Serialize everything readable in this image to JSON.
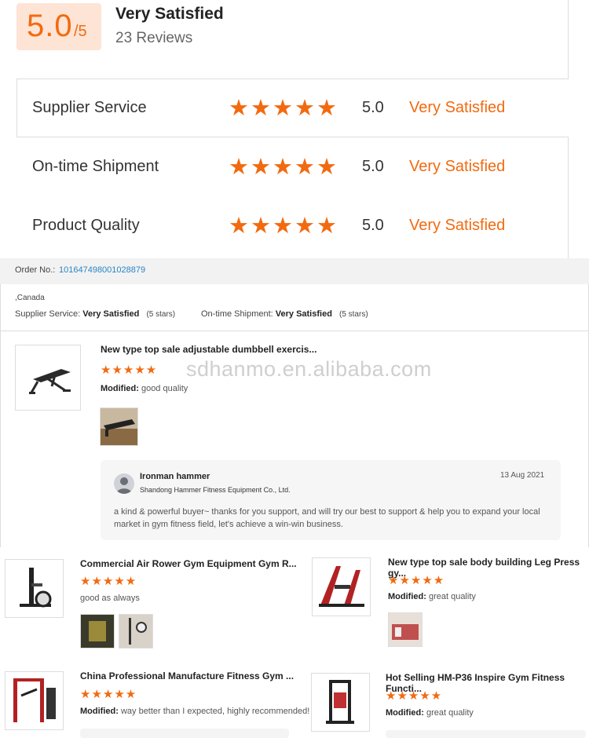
{
  "summary": {
    "score": "5.0",
    "score_max": "/5",
    "title": "Very Satisfied",
    "reviews": "23 Reviews"
  },
  "ratings": [
    {
      "label": "Supplier Service",
      "stars": "★★★★★",
      "value": "5.0",
      "status": "Very Satisfied"
    },
    {
      "label": "On-time Shipment",
      "stars": "★★★★★",
      "value": "5.0",
      "status": "Very Satisfied"
    },
    {
      "label": "Product Quality",
      "stars": "★★★★★",
      "value": "5.0",
      "status": "Very Satisfied"
    }
  ],
  "order": {
    "label": "Order No.:",
    "number": "101647498001028879",
    "location": ",Canada",
    "supplier_service_label": "Supplier Service:",
    "supplier_service_value": "Very Satisfied",
    "supplier_service_stars": "(5 stars)",
    "shipment_label": "On-time Shipment:",
    "shipment_value": "Very Satisfied",
    "shipment_stars": "(5 stars)"
  },
  "main_review": {
    "title": "New type top sale adjustable dumbbell exercis...",
    "stars": "★★★★★",
    "modified_label": "Modified:",
    "text": "good quality",
    "watermark": "sdhanmo.en.alibaba.com"
  },
  "reply": {
    "name": "Ironman hammer",
    "company": "Shandong Hammer Fitness Equipment Co., Ltd.",
    "date": "13 Aug 2021",
    "text": "a kind & powerful buyer~ thanks for you support, and will try our best to support & help you to expand your local market in gym fitness field, let's achieve a win-win business."
  },
  "reviews": [
    {
      "title": "Commercial Air Rower Gym Equipment Gym R...",
      "stars": "★★★★★",
      "modified": "",
      "text": "good as always"
    },
    {
      "title": "New type top sale body building Leg Press gy...",
      "stars": "★★★★★",
      "modified": "Modified:",
      "text": "great quality"
    },
    {
      "title": "China Professional Manufacture Fitness Gym ...",
      "stars": "★★★★★",
      "modified": "Modified:",
      "text": "way better than I expected, highly recommended!"
    },
    {
      "title": "Hot Selling HM-P36 Inspire Gym Fitness Functi...",
      "stars": "★★★★★",
      "modified": "Modified:",
      "text": "great quality"
    }
  ],
  "colors": {
    "accent": "#f26a10",
    "link": "#2a86c5",
    "score_bg": "#fde4d5"
  }
}
